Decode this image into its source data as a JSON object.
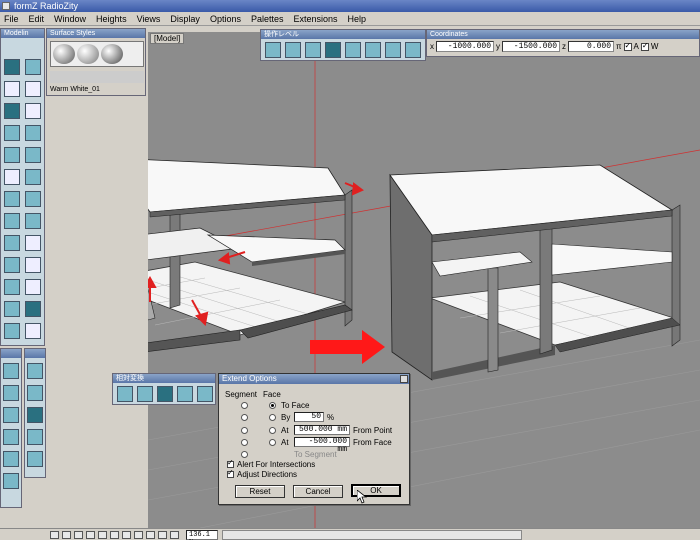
{
  "window": {
    "title": "formZ RadioZity"
  },
  "menu": [
    "File",
    "Edit",
    "Window",
    "Heights",
    "Views",
    "Display",
    "Options",
    "Palettes",
    "Extensions",
    "Help"
  ],
  "palettes": {
    "modeling": "Modelin",
    "surface_styles": "Surface Styles",
    "surface_name": "Warm White_01",
    "operation_level": "操作レベル",
    "transform": "相対変換",
    "coordinates": "Coordinates"
  },
  "coordinates": {
    "x_label": "x",
    "x_value": "-1000.000",
    "y_label": "y",
    "y_value": "-1500.000",
    "z_label": "z",
    "z_value": "0.000",
    "units": "π",
    "check_a": "A",
    "check_w": "W"
  },
  "view": {
    "label": "[Model]"
  },
  "dialog": {
    "title": "Extend Options",
    "segment_header": "Segment",
    "face_header": "Face",
    "options": [
      {
        "label": "To Face",
        "selected": true
      },
      {
        "label": "By",
        "value": "50",
        "unit": "%"
      },
      {
        "label": "At",
        "value": "500.000 mm",
        "suffix": "From Point"
      },
      {
        "label": "At",
        "value": "-500.000 mm",
        "suffix": "From Face"
      },
      {
        "label": "To Segment",
        "disabled": true
      }
    ],
    "alert_intersections": "Alert For Intersections",
    "adjust_directions": "Adjust Directions",
    "reset_label": "Reset",
    "cancel_label": "Cancel",
    "ok_label": "OK"
  },
  "status": {
    "zoom": "136.1 %"
  },
  "colors": {
    "arrow": "#e02020",
    "accent": "#4a6aa8",
    "tool": "#7ab8c8"
  }
}
